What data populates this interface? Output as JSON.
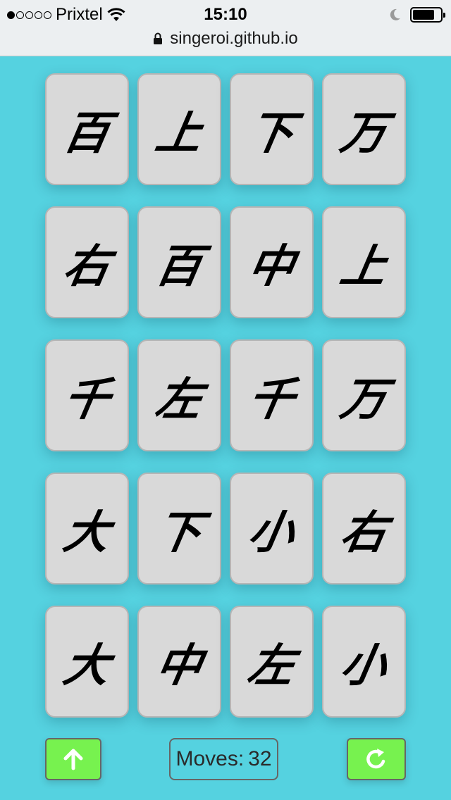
{
  "status_bar": {
    "carrier": "Prixtel",
    "time": "15:10"
  },
  "url_bar": {
    "url": "singeroi.github.io"
  },
  "board": {
    "cards": [
      "百",
      "上",
      "下",
      "万",
      "右",
      "百",
      "中",
      "上",
      "千",
      "左",
      "千",
      "万",
      "大",
      "下",
      "小",
      "右",
      "大",
      "中",
      "左",
      "小"
    ]
  },
  "controls": {
    "moves_label": "Moves:",
    "moves_count": "32",
    "up_icon": "arrow-up-icon",
    "restart_icon": "restart-icon"
  },
  "colors": {
    "background": "#55d2e0",
    "card": "#d9d9d9",
    "button": "#77f24f"
  }
}
